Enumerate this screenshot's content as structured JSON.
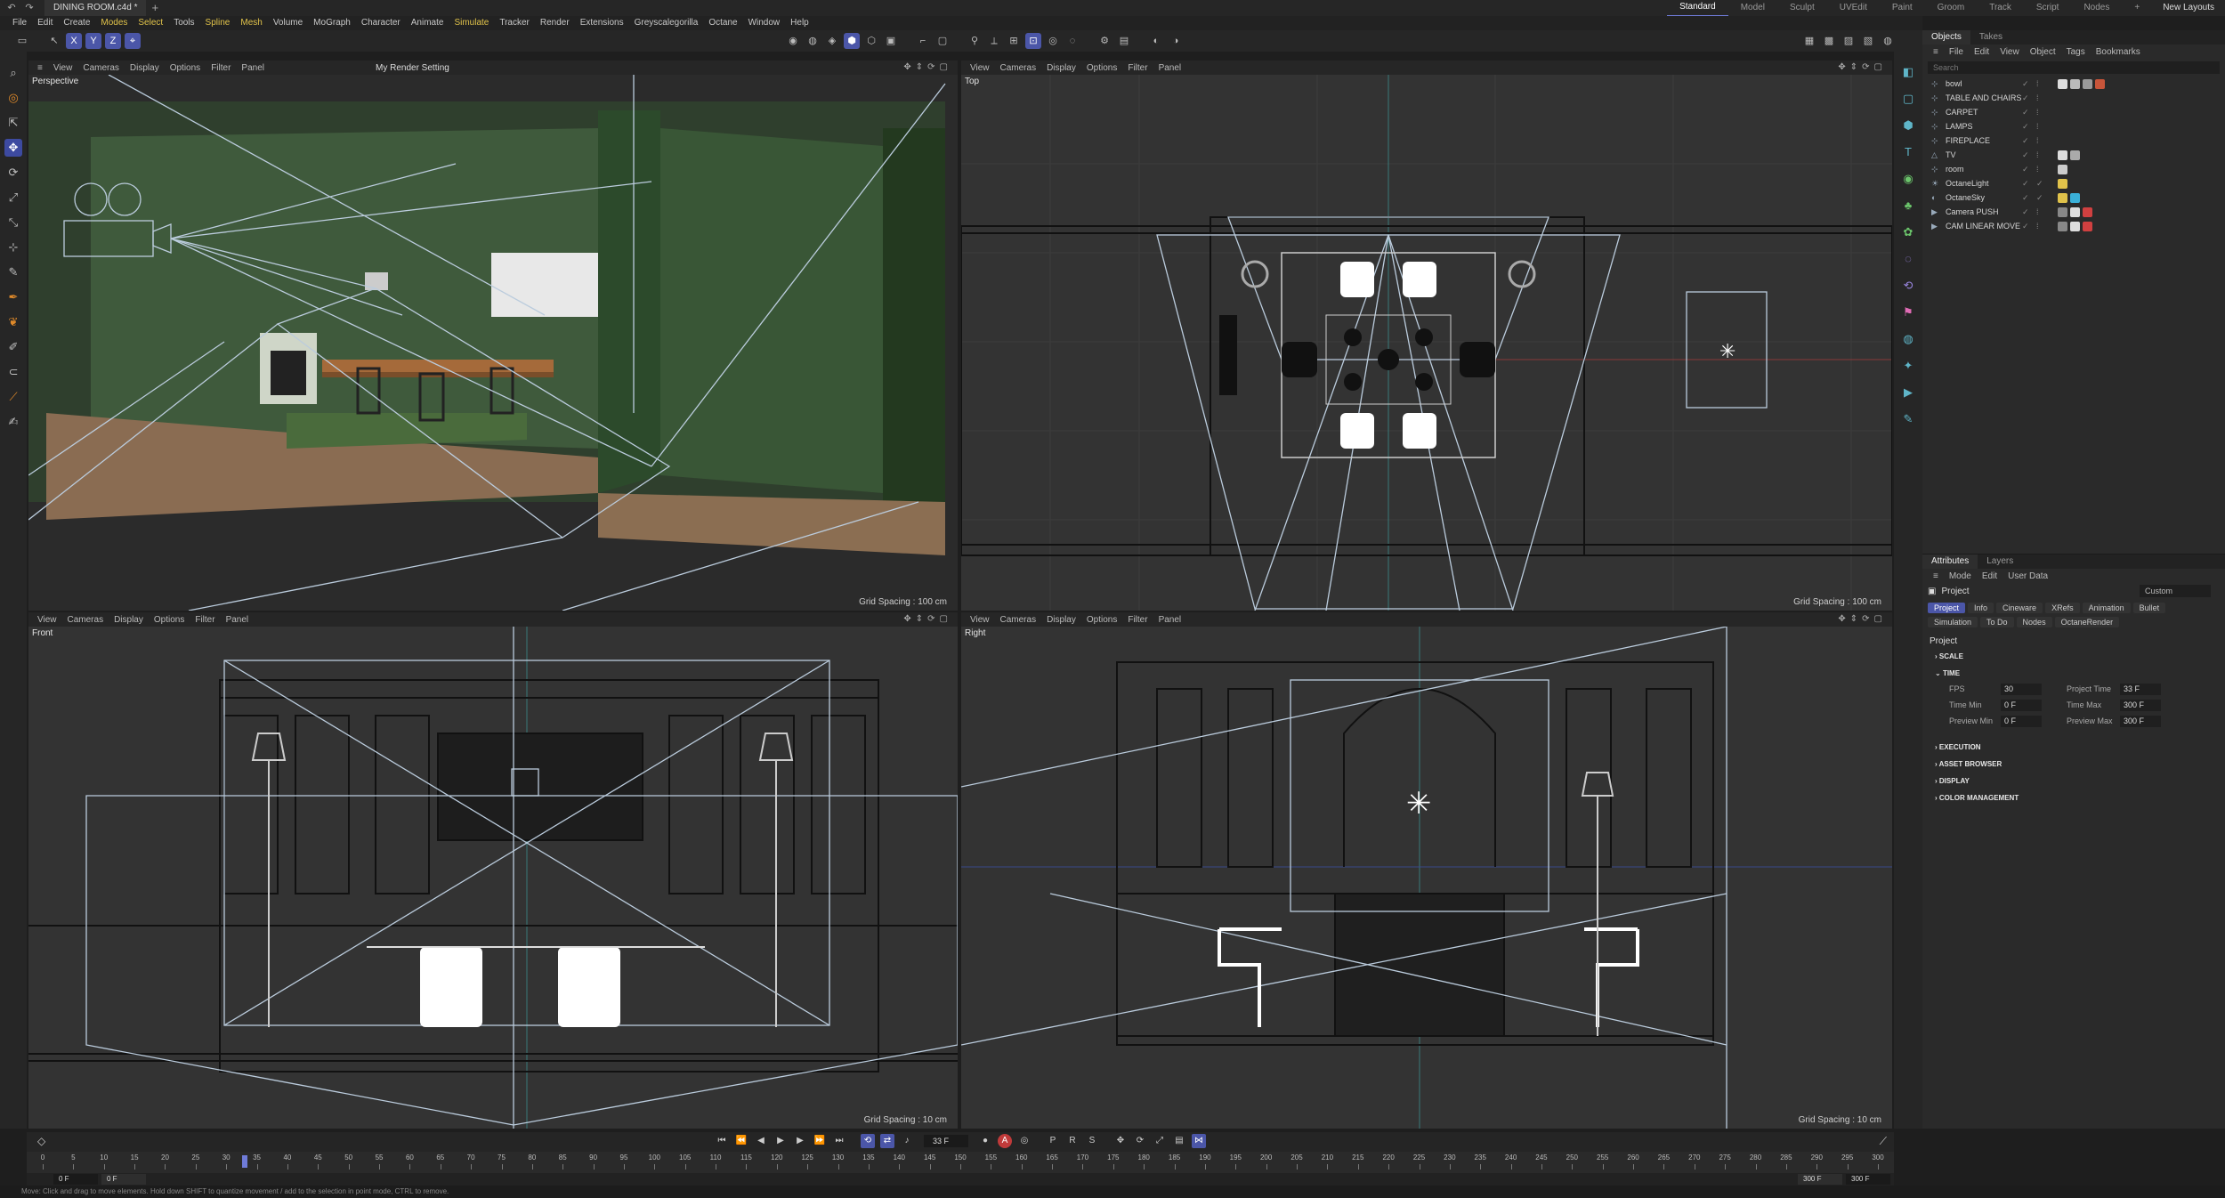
{
  "titlebar": {
    "document_tab": "DINING ROOM.c4d *",
    "layouts": [
      "Standard",
      "Model",
      "Sculpt",
      "UVEdit",
      "Paint",
      "Groom",
      "Track",
      "Script",
      "Nodes"
    ],
    "new_layouts": "New Layouts"
  },
  "menubar": {
    "items": [
      "File",
      "Edit",
      "Create",
      "Modes",
      "Select",
      "Tools",
      "Spline",
      "Mesh",
      "Volume",
      "MoGraph",
      "Character",
      "Animate",
      "Simulate",
      "Tracker",
      "Render",
      "Extensions",
      "Greyscalegorilla",
      "Octane",
      "Window",
      "Help"
    ]
  },
  "toolbar": {
    "axes": [
      "X",
      "Y",
      "Z"
    ]
  },
  "viewports": {
    "menu": [
      "View",
      "Cameras",
      "Display",
      "Options",
      "Filter",
      "Panel"
    ],
    "perspective": {
      "label": "Perspective",
      "render_setting": "My Render Setting",
      "grid": "Grid Spacing : 100 cm"
    },
    "top": {
      "label": "Top",
      "grid": "Grid Spacing : 100 cm"
    },
    "front": {
      "label": "Front",
      "grid": "Grid Spacing : 10 cm"
    },
    "right": {
      "label": "Right",
      "grid": "Grid Spacing : 10 cm"
    }
  },
  "objects": {
    "tabs": [
      "Objects",
      "Takes"
    ],
    "menu": [
      "File",
      "Edit",
      "View",
      "Object",
      "Tags",
      "Bookmarks"
    ],
    "search_placeholder": "Search",
    "items": [
      {
        "name": "bowl"
      },
      {
        "name": "TABLE AND CHAIRS"
      },
      {
        "name": "CARPET"
      },
      {
        "name": "LAMPS"
      },
      {
        "name": "FIREPLACE"
      },
      {
        "name": "TV"
      },
      {
        "name": "room"
      },
      {
        "name": "OctaneLight"
      },
      {
        "name": "OctaneSky"
      },
      {
        "name": "Camera PUSH"
      },
      {
        "name": "CAM LINEAR MOVE"
      }
    ]
  },
  "attributes": {
    "tabs": [
      "Attributes",
      "Layers"
    ],
    "menu": [
      "Mode",
      "Edit",
      "User Data"
    ],
    "object": "Project",
    "preset": "Custom",
    "subtabs": [
      "Project",
      "Info",
      "Cineware",
      "XRefs",
      "Animation",
      "Bullet",
      "Simulation",
      "To Do",
      "Nodes",
      "OctaneRender"
    ],
    "section": "Project",
    "groups": {
      "scale": "SCALE",
      "time": "TIME",
      "execution": "EXECUTION",
      "asset_browser": "ASSET BROWSER",
      "display": "DISPLAY",
      "color_management": "COLOR MANAGEMENT"
    },
    "time_fields": {
      "fps_label": "FPS",
      "fps": "30",
      "project_time_label": "Project Time",
      "project_time": "33 F",
      "time_min_label": "Time Min",
      "time_min": "0 F",
      "time_max_label": "Time Max",
      "time_max": "300 F",
      "preview_min_label": "Preview Min",
      "preview_min": "0 F",
      "preview_max_label": "Preview Max",
      "preview_max": "300 F"
    }
  },
  "timeline": {
    "current_frame": "33 F",
    "ticks": [
      0,
      5,
      10,
      15,
      20,
      25,
      30,
      35,
      40,
      45,
      50,
      55,
      60,
      65,
      70,
      75,
      80,
      85,
      90,
      95,
      100,
      105,
      110,
      115,
      120,
      125,
      130,
      135,
      140,
      145,
      150,
      155,
      160,
      165,
      170,
      175,
      180,
      185,
      190,
      195,
      200,
      205,
      210,
      215,
      220,
      225,
      230,
      235,
      240,
      245,
      250,
      255,
      260,
      265,
      270,
      275,
      280,
      285,
      290,
      295,
      300
    ],
    "playhead": 33,
    "range_start": "0 F",
    "range_start2": "0 F",
    "range_end": "300 F",
    "range_end2": "300 F"
  },
  "status": "Move: Click and drag to move elements. Hold down SHIFT to quantize movement / add to the selection in point mode, CTRL to remove."
}
